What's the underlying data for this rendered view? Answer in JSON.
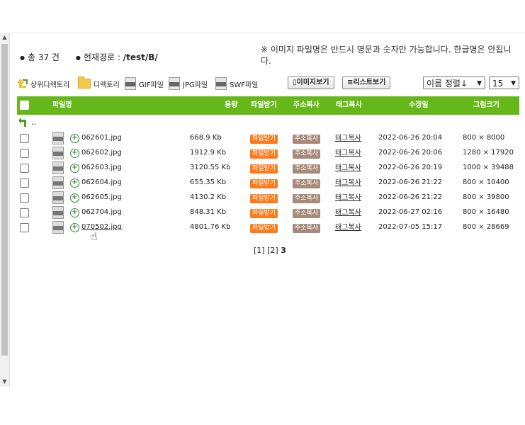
{
  "summary": {
    "count_label": "총 37 건",
    "path_label": "현재경로 :",
    "path_value": "/test/B/"
  },
  "notice": "※ 이미지 파일명은 반드시 영문과 숫자만 가능합니다. 한글명은 안됩니다.",
  "toolbar": {
    "parent_dir": "상위디렉토리",
    "directory": "디렉토리",
    "gif": "GIF파일",
    "jpg": "JPG파일",
    "swf": "SWF파일",
    "image_view": "이미지보기",
    "list_view": "리스트보기",
    "sort_selected": "이름 정렬↓",
    "page_size_selected": "15"
  },
  "icons": {
    "folder": "folder-icon",
    "gif": "gif-file-icon",
    "jpg": "jpg-file-icon",
    "swf": "swf-file-icon",
    "zoom": "zoom-in-icon",
    "parent": "up-arrow-icon"
  },
  "colors": {
    "header_bg": "#66b81a",
    "download_badge": "#ff7a1a",
    "address_badge": "#a88a7a"
  },
  "table": {
    "headers": {
      "filename": "파일명",
      "size": "용량",
      "download": "파일받기",
      "addr_copy": "주소복사",
      "tag_copy": "태그복사",
      "modified": "수정일",
      "img_size": "그림크기"
    },
    "parent_label": "..",
    "rows": [
      {
        "name": "062601.jpg",
        "size": "668.9 Kb",
        "download": "파일받기",
        "addr": "주소복사",
        "tag": "태그복사",
        "date": "2022-06-26 20:04",
        "dims": "800 × 8000"
      },
      {
        "name": "062602.jpg",
        "size": "1912.9 Kb",
        "download": "파일받기",
        "addr": "주소복사",
        "tag": "태그복사",
        "date": "2022-06-26 20:06",
        "dims": "1280 × 17920"
      },
      {
        "name": "062603.jpg",
        "size": "3120.55 Kb",
        "download": "파일받기",
        "addr": "주소복사",
        "tag": "태그복사",
        "date": "2022-06-26 20:19",
        "dims": "1000 × 39488"
      },
      {
        "name": "062604.jpg",
        "size": "655.35 Kb",
        "download": "파일받기",
        "addr": "주소복사",
        "tag": "태그복사",
        "date": "2022-06-26 21:22",
        "dims": "800 × 10400"
      },
      {
        "name": "062605.jpg",
        "size": "4130.2 Kb",
        "download": "파일받기",
        "addr": "주소복사",
        "tag": "태그복사",
        "date": "2022-06-26 21:22",
        "dims": "800 × 39800"
      },
      {
        "name": "062704.jpg",
        "size": "848.31 Kb",
        "download": "파일받기",
        "addr": "주소복사",
        "tag": "태그복사",
        "date": "2022-06-27 02:16",
        "dims": "800 × 16480"
      },
      {
        "name": "070502.jpg",
        "size": "4801.76 Kb",
        "download": "파일받기",
        "addr": "주소복사",
        "tag": "태그복사",
        "date": "2022-07-05 15:17",
        "dims": "800 × 28669"
      }
    ]
  },
  "pager": {
    "p1": "[1]",
    "p2": "[2]",
    "current": "3"
  }
}
